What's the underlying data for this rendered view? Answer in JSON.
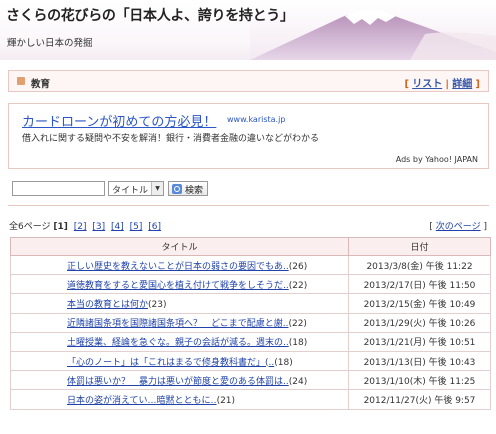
{
  "header": {
    "site_title": "さくらの花びらの「日本人よ、誇りを持とう」",
    "subtitle": "輝かしい日本の発掘"
  },
  "category": {
    "label": "教育",
    "open_bracket": "[",
    "list_link": "リスト",
    "separator": "|",
    "detail_link": "詳細",
    "close_bracket": "]"
  },
  "ad": {
    "title": "カードローンが初めての方必見！",
    "url": "www.karista.jp",
    "description": "借入れに関する疑問や不安を解消！銀行・消費者金融の違いなどがわかる",
    "credit": "Ads by Yahoo! JAPAN"
  },
  "search": {
    "input_value": "",
    "select_value": "タイトル",
    "button_label": "検索"
  },
  "pager": {
    "total_label": "全6ページ",
    "current": "[1]",
    "pages": [
      "[2]",
      "[3]",
      "[4]",
      "[5]",
      "[6]"
    ],
    "next_open": "[",
    "next_label": "次のページ",
    "next_close": "]"
  },
  "table": {
    "headers": [
      "タイトル",
      "日付"
    ],
    "rows": [
      {
        "title": "正しい歴史を教えないことが日本の弱さの要因でもあ..",
        "count": "(26)",
        "date": "2013/3/8(金) 午後 11:22"
      },
      {
        "title": "道徳教育をすると愛国心を植え付けて戦争をしそうだ..",
        "count": "(22)",
        "date": "2013/2/17(日) 午後 11:50"
      },
      {
        "title": "本当の教育とは何か",
        "count": "(23)",
        "date": "2013/2/15(金) 午後 10:49"
      },
      {
        "title": "近隣諸国条項を国際諸国条項へ？　どこまで配慮と謝..",
        "count": "(22)",
        "date": "2013/1/29(火) 午後 10:26"
      },
      {
        "title": "土曜授業、経論を急ぐな。親子の会話が減る。週末の..",
        "count": "(18)",
        "date": "2013/1/21(月) 午後 10:51"
      },
      {
        "title": "「心のノート」は「これはまるで修身教科書だ」(..",
        "count": "(18)",
        "date": "2013/1/13(日) 午後 10:43"
      },
      {
        "title": "体罰は悪いか？　暴力は悪いが節度と愛のある体罰は..",
        "count": "(24)",
        "date": "2013/1/10(木) 午後 11:25"
      },
      {
        "title": "日本の姿が消えてい…暗黙とともに‥",
        "count": "(21)",
        "date": "2012/11/27(火) 午後 9:57"
      }
    ]
  }
}
